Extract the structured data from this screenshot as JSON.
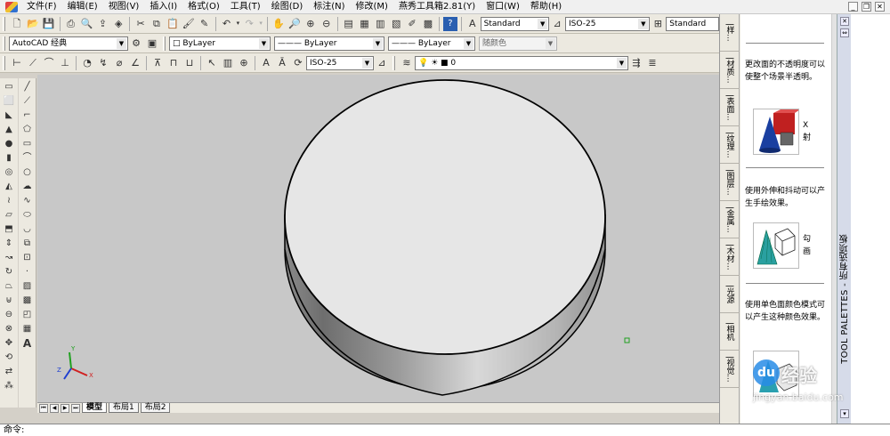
{
  "menu": {
    "items": [
      "文件(F)",
      "编辑(E)",
      "视图(V)",
      "插入(I)",
      "格式(O)",
      "工具(T)",
      "绘图(D)",
      "标注(N)",
      "修改(M)",
      "燕秀工具箱2.81(Y)",
      "窗口(W)",
      "帮助(H)"
    ]
  },
  "toolbar1": {
    "text_style": "Standard",
    "dim_style": "ISO-25",
    "table_style": "Standard"
  },
  "toolbar2": {
    "workspace": "AutoCAD 经典",
    "color": "ByLayer",
    "linetype": "ByLayer",
    "lineweight": "ByLayer",
    "plotstyle": "随颜色"
  },
  "toolbar3": {
    "dim_style": "ISO-25",
    "layer": "0"
  },
  "layout_tabs": [
    "模型",
    "布局1",
    "布局2"
  ],
  "command": {
    "prompt": "命令:"
  },
  "palette": {
    "title": "TOOL PALETTES - 所有选项板",
    "tabs": [
      "|样...",
      "|材质...",
      "|表面...",
      "|纹理...",
      "|图层...",
      "|金属...",
      "|木材...",
      "|光源",
      "|相机",
      "|视觉..."
    ],
    "descriptions": [
      "更改面的不透明度可以使整个场景半透明。",
      "使用外伸和抖动可以产生手绘效果。",
      "使用单色面颜色模式可以产生这种颜色效果。"
    ],
    "tool_labels": [
      "X\n射",
      "勾\n画",
      ""
    ]
  },
  "watermark": {
    "text": "经验",
    "url": "jingyan.baidu.com"
  },
  "colors": {
    "canvas": "#c8c8c8",
    "cylinder_top": "#e6e6e6",
    "cylinder_edge": "#000000"
  }
}
